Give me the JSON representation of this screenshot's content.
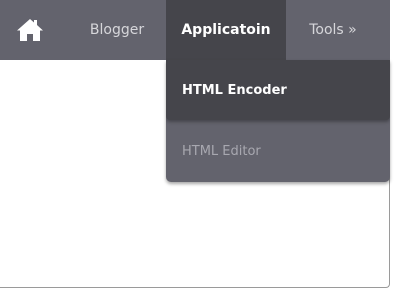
{
  "nav": {
    "home_icon": "home-icon",
    "items": [
      {
        "label": "Blogger"
      },
      {
        "label": "Applicatoin"
      },
      {
        "label": "Tools »"
      }
    ]
  },
  "dropdown": {
    "items": [
      {
        "label": "HTML Encoder"
      },
      {
        "label": "HTML Editor"
      }
    ]
  },
  "colors": {
    "navbar": "#63636d",
    "active": "#45454b",
    "text_active": "#ffffff",
    "text_inactive": "#d6d6da",
    "text_muted": "#a8a8b0"
  }
}
